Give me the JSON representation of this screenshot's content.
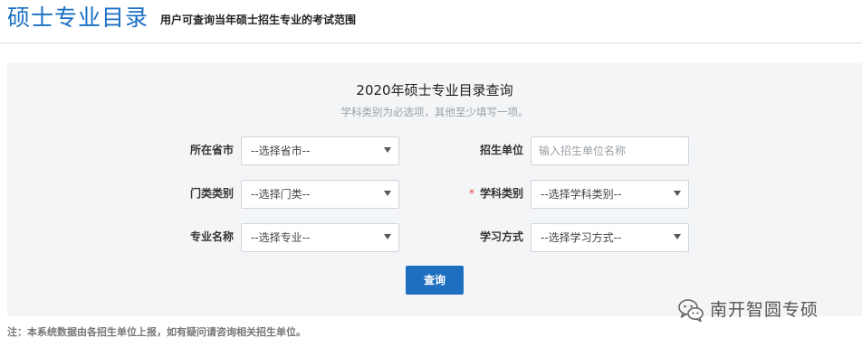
{
  "header": {
    "title": "硕士专业目录",
    "subtitle": "用户可查询当年硕士招生专业的考试范围"
  },
  "form": {
    "title": "2020年硕士专业目录查询",
    "hint": "学科类别为必选项，其他至少填写一项。",
    "fields": {
      "province": {
        "label": "所在省市",
        "value": "--选择省市--"
      },
      "unit": {
        "label": "招生单位",
        "placeholder": "输入招生单位名称"
      },
      "category": {
        "label": "门类类别",
        "value": "--选择门类--"
      },
      "subject": {
        "label": "学科类别",
        "value": "--选择学科类别--",
        "required": true,
        "required_mark": "*"
      },
      "major": {
        "label": "专业名称",
        "value": "--选择专业--"
      },
      "study_mode": {
        "label": "学习方式",
        "value": "--选择学习方式--"
      }
    },
    "query_label": "查询"
  },
  "watermark": {
    "text": "南开智圆专硕",
    "icon": "wechat-icon"
  },
  "footer": {
    "note": "注：本系统数据由各招生单位上报，如有疑问请咨询相关招生单位。"
  },
  "colors": {
    "accent": "#1f6fc0",
    "title_blue": "#1a6fc4",
    "panel_bg": "#f4f5f7",
    "required": "#e03a3a"
  }
}
